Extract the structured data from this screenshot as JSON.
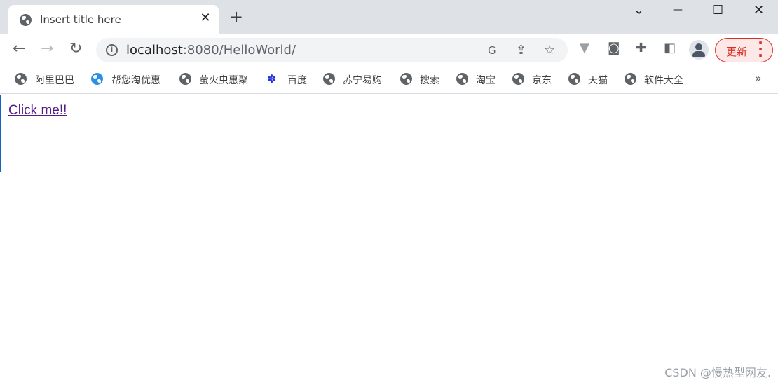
{
  "tab": {
    "title": "Insert title here",
    "close": "✕",
    "new_tab": "+"
  },
  "window_controls": {
    "dropdown": "⌄",
    "minimize": "—",
    "maximize": "☐",
    "close": "✕"
  },
  "toolbar": {
    "back": "←",
    "forward": "→",
    "reload": "↻",
    "url_host": "localhost",
    "url_rest": ":8080/HelloWorld/",
    "update_label": "更新",
    "menu": "⋮"
  },
  "bookmarks": [
    {
      "label": "阿里巴巴",
      "icon": "globe-icon"
    },
    {
      "label": "帮您淘优惠",
      "icon": "dolphin-icon"
    },
    {
      "label": "萤火虫惠聚",
      "icon": "globe-icon"
    },
    {
      "label": "百度",
      "icon": "baidu-paw-icon"
    },
    {
      "label": "苏宁易购",
      "icon": "globe-icon"
    },
    {
      "label": "搜索",
      "icon": "globe-icon"
    },
    {
      "label": "淘宝",
      "icon": "globe-icon"
    },
    {
      "label": "京东",
      "icon": "globe-icon"
    },
    {
      "label": "天猫",
      "icon": "globe-icon"
    },
    {
      "label": "软件大全",
      "icon": "globe-icon"
    }
  ],
  "bookmarks_more": "»",
  "page": {
    "link": "Click me!!"
  },
  "watermark": "CSDN @慢热型网友."
}
